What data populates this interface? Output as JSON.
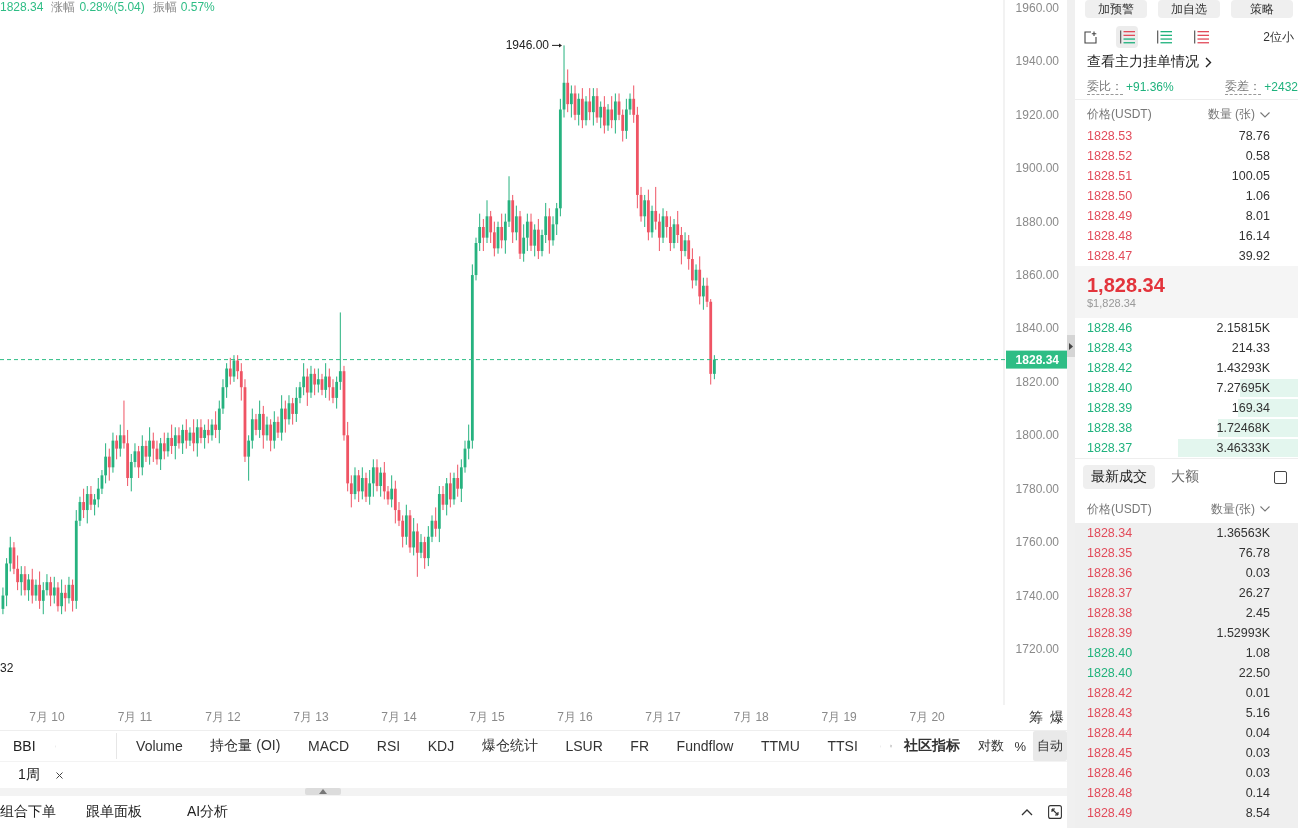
{
  "header": {
    "price": "1828.34",
    "stats": [
      {
        "label": "涨幅",
        "value": "0.28%(5.04)"
      },
      {
        "label": "振幅",
        "value": "0.57%"
      }
    ]
  },
  "chart": {
    "chart_data": [
      {
        "type": "candlestick",
        "categories": [
          null,
          null,
          null,
          null,
          null,
          null,
          null,
          null,
          null,
          null,
          null,
          null,
          "7月 10",
          null,
          null,
          null,
          null,
          null,
          null,
          null,
          null,
          null,
          null,
          null,
          null,
          null,
          null,
          null,
          null,
          null,
          null,
          null,
          null,
          null,
          null,
          null,
          "7月 11",
          null,
          null,
          null,
          null,
          null,
          null,
          null,
          null,
          null,
          null,
          null,
          null,
          null,
          null,
          null,
          null,
          null,
          null,
          null,
          null,
          null,
          null,
          null,
          "7月 12",
          null,
          null,
          null,
          null,
          null,
          null,
          null,
          null,
          null,
          null,
          null,
          null,
          null,
          null,
          null,
          null,
          null,
          null,
          null,
          null,
          null,
          null,
          null,
          "7月 13",
          null,
          null,
          null,
          null,
          null,
          null,
          null,
          null,
          null,
          null,
          null,
          null,
          null,
          null,
          null,
          null,
          null,
          null,
          null,
          null,
          null,
          null,
          null,
          "7月 14",
          null,
          null,
          null,
          null,
          null,
          null,
          null,
          null,
          null,
          null,
          null,
          null,
          null,
          null,
          null,
          null,
          null,
          null,
          null,
          null,
          null,
          null,
          null,
          "7月 15",
          null,
          null,
          null,
          null,
          null,
          null,
          null,
          null,
          null,
          null,
          null,
          null,
          null,
          null,
          null,
          null,
          null,
          null,
          null,
          null,
          null,
          null,
          null,
          "7月 16",
          null,
          null,
          null,
          null,
          null,
          null,
          null,
          null,
          null,
          null,
          null,
          null,
          null,
          null,
          null,
          null,
          null,
          null,
          null,
          null,
          null,
          null,
          null,
          "7月 17",
          null,
          null,
          null,
          null,
          null,
          null,
          null,
          null,
          null,
          null,
          null,
          null,
          null,
          null,
          null,
          null,
          null,
          null,
          null,
          null,
          null,
          null,
          null,
          "7月 18",
          null,
          null,
          null,
          null,
          null,
          null,
          null,
          null,
          null,
          null,
          null,
          null,
          null,
          null,
          null,
          null,
          null,
          null,
          null,
          null,
          null,
          null,
          null,
          "7月 19",
          null,
          null,
          null,
          null,
          null,
          null,
          null,
          null,
          null,
          null,
          null,
          null,
          null,
          null,
          null,
          null,
          null,
          null,
          null,
          null,
          null,
          null,
          null,
          "7月 20",
          null,
          null,
          null,
          null,
          null,
          null,
          null,
          null,
          null,
          null,
          null,
          null,
          null,
          null,
          null,
          null,
          null,
          null,
          null,
          null
        ],
        "ohlc": [
          [
            1735,
            1743,
            1733,
            1740
          ],
          [
            1740,
            1754,
            1736,
            1752
          ],
          [
            1752,
            1762,
            1749,
            1758
          ],
          [
            1758,
            1760,
            1748,
            1750
          ],
          [
            1750,
            1755,
            1742,
            1745
          ],
          [
            1745,
            1751,
            1740,
            1748
          ],
          [
            1748,
            1751,
            1740,
            1742
          ],
          [
            1742,
            1748,
            1738,
            1746
          ],
          [
            1746,
            1750,
            1737,
            1740
          ],
          [
            1740,
            1746,
            1738,
            1744
          ],
          [
            1744,
            1749,
            1735,
            1738
          ],
          [
            1738,
            1745,
            1733,
            1742
          ],
          [
            1742,
            1748,
            1740,
            1745
          ],
          [
            1745,
            1747,
            1736,
            1740
          ],
          [
            1740,
            1747,
            1737,
            1743
          ],
          [
            1743,
            1745,
            1734,
            1736
          ],
          [
            1736,
            1746,
            1733,
            1741
          ],
          [
            1741,
            1744,
            1734,
            1739
          ],
          [
            1739,
            1747,
            1737,
            1744
          ],
          [
            1744,
            1746,
            1734,
            1738
          ],
          [
            1738,
            1772,
            1735,
            1768
          ],
          [
            1768,
            1777,
            1766,
            1775
          ],
          [
            1775,
            1780,
            1769,
            1772
          ],
          [
            1772,
            1781,
            1767,
            1778
          ],
          [
            1778,
            1781,
            1772,
            1774
          ],
          [
            1774,
            1778,
            1770,
            1776
          ],
          [
            1776,
            1784,
            1773,
            1780
          ],
          [
            1780,
            1787,
            1778,
            1785
          ],
          [
            1785,
            1797,
            1782,
            1792
          ],
          [
            1792,
            1795,
            1783,
            1788
          ],
          [
            1788,
            1801,
            1786,
            1798
          ],
          [
            1798,
            1800,
            1791,
            1795
          ],
          [
            1795,
            1804,
            1792,
            1800
          ],
          [
            1800,
            1813,
            1795,
            1797
          ],
          [
            1797,
            1802,
            1781,
            1784
          ],
          [
            1784,
            1793,
            1779,
            1790
          ],
          [
            1790,
            1797,
            1788,
            1794
          ],
          [
            1794,
            1796,
            1784,
            1788
          ],
          [
            1788,
            1800,
            1785,
            1796
          ],
          [
            1796,
            1798,
            1790,
            1792
          ],
          [
            1792,
            1803,
            1789,
            1798
          ],
          [
            1798,
            1801,
            1790,
            1795
          ],
          [
            1795,
            1798,
            1789,
            1791
          ],
          [
            1791,
            1799,
            1787,
            1797
          ],
          [
            1797,
            1801,
            1791,
            1794
          ],
          [
            1794,
            1801,
            1792,
            1799
          ],
          [
            1799,
            1804,
            1793,
            1796
          ],
          [
            1796,
            1803,
            1791,
            1800
          ],
          [
            1800,
            1803,
            1795,
            1797
          ],
          [
            1797,
            1804,
            1793,
            1802
          ],
          [
            1802,
            1806,
            1795,
            1798
          ],
          [
            1798,
            1803,
            1796,
            1801
          ],
          [
            1801,
            1806,
            1794,
            1797
          ],
          [
            1797,
            1806,
            1792,
            1803
          ],
          [
            1803,
            1806,
            1797,
            1799
          ],
          [
            1799,
            1804,
            1795,
            1802
          ],
          [
            1802,
            1806,
            1797,
            1800
          ],
          [
            1800,
            1806,
            1798,
            1804
          ],
          [
            1804,
            1809,
            1799,
            1802
          ],
          [
            1802,
            1813,
            1797,
            1810
          ],
          [
            1810,
            1821,
            1808,
            1818
          ],
          [
            1818,
            1827,
            1814,
            1825
          ],
          [
            1825,
            1829,
            1819,
            1822
          ],
          [
            1822,
            1830,
            1820,
            1828
          ],
          [
            1828,
            1830,
            1821,
            1824
          ],
          [
            1824,
            1827,
            1813,
            1818
          ],
          [
            1818,
            1821,
            1790,
            1792
          ],
          [
            1792,
            1800,
            1783,
            1798
          ],
          [
            1798,
            1810,
            1795,
            1806
          ],
          [
            1806,
            1808,
            1800,
            1802
          ],
          [
            1802,
            1813,
            1799,
            1808
          ],
          [
            1808,
            1811,
            1795,
            1800
          ],
          [
            1800,
            1807,
            1798,
            1804
          ],
          [
            1804,
            1806,
            1794,
            1798
          ],
          [
            1798,
            1809,
            1795,
            1805
          ],
          [
            1805,
            1807,
            1799,
            1801
          ],
          [
            1801,
            1815,
            1798,
            1810
          ],
          [
            1810,
            1813,
            1801,
            1806
          ],
          [
            1806,
            1815,
            1804,
            1812
          ],
          [
            1812,
            1814,
            1804,
            1808
          ],
          [
            1808,
            1818,
            1805,
            1814
          ],
          [
            1814,
            1820,
            1812,
            1818
          ],
          [
            1818,
            1827,
            1815,
            1822
          ],
          [
            1822,
            1825,
            1811,
            1816
          ],
          [
            1816,
            1826,
            1814,
            1823
          ],
          [
            1823,
            1825,
            1815,
            1819
          ],
          [
            1819,
            1825,
            1816,
            1821
          ],
          [
            1821,
            1823,
            1815,
            1817
          ],
          [
            1817,
            1827,
            1814,
            1822
          ],
          [
            1822,
            1825,
            1813,
            1818
          ],
          [
            1818,
            1821,
            1812,
            1814
          ],
          [
            1814,
            1822,
            1810,
            1820
          ],
          [
            1820,
            1846,
            1817,
            1824
          ],
          [
            1824,
            1826,
            1798,
            1800
          ],
          [
            1800,
            1805,
            1779,
            1782
          ],
          [
            1782,
            1785,
            1773,
            1778
          ],
          [
            1778,
            1788,
            1776,
            1785
          ],
          [
            1785,
            1787,
            1775,
            1779
          ],
          [
            1779,
            1788,
            1776,
            1784
          ],
          [
            1784,
            1786,
            1775,
            1777
          ],
          [
            1777,
            1787,
            1774,
            1782
          ],
          [
            1782,
            1791,
            1777,
            1788
          ],
          [
            1788,
            1791,
            1779,
            1781
          ],
          [
            1781,
            1788,
            1777,
            1786
          ],
          [
            1786,
            1790,
            1776,
            1779
          ],
          [
            1779,
            1781,
            1774,
            1776
          ],
          [
            1776,
            1785,
            1773,
            1780
          ],
          [
            1780,
            1783,
            1767,
            1772
          ],
          [
            1772,
            1775,
            1766,
            1768
          ],
          [
            1768,
            1770,
            1758,
            1762
          ],
          [
            1762,
            1774,
            1759,
            1770
          ],
          [
            1770,
            1772,
            1756,
            1758
          ],
          [
            1758,
            1769,
            1755,
            1764
          ],
          [
            1764,
            1767,
            1747,
            1756
          ],
          [
            1756,
            1763,
            1754,
            1760
          ],
          [
            1760,
            1762,
            1750,
            1754
          ],
          [
            1754,
            1766,
            1751,
            1762
          ],
          [
            1762,
            1770,
            1760,
            1768
          ],
          [
            1768,
            1773,
            1762,
            1765
          ],
          [
            1765,
            1781,
            1760,
            1778
          ],
          [
            1778,
            1781,
            1772,
            1774
          ],
          [
            1774,
            1784,
            1770,
            1782
          ],
          [
            1782,
            1786,
            1773,
            1776
          ],
          [
            1776,
            1786,
            1774,
            1784
          ],
          [
            1784,
            1789,
            1777,
            1780
          ],
          [
            1780,
            1791,
            1775,
            1788
          ],
          [
            1788,
            1798,
            1786,
            1795
          ],
          [
            1795,
            1804,
            1791,
            1798
          ],
          [
            1798,
            1864,
            1795,
            1860
          ],
          [
            1860,
            1874,
            1858,
            1872
          ],
          [
            1872,
            1883,
            1869,
            1878
          ],
          [
            1878,
            1881,
            1869,
            1874
          ],
          [
            1874,
            1888,
            1872,
            1882
          ],
          [
            1882,
            1884,
            1872,
            1876
          ],
          [
            1876,
            1880,
            1867,
            1870
          ],
          [
            1870,
            1880,
            1868,
            1878
          ],
          [
            1878,
            1883,
            1870,
            1873
          ],
          [
            1873,
            1883,
            1868,
            1880
          ],
          [
            1880,
            1897,
            1878,
            1888
          ],
          [
            1888,
            1890,
            1872,
            1876
          ],
          [
            1876,
            1886,
            1873,
            1882
          ],
          [
            1882,
            1884,
            1866,
            1868
          ],
          [
            1868,
            1879,
            1865,
            1874
          ],
          [
            1874,
            1883,
            1869,
            1880
          ],
          [
            1880,
            1883,
            1869,
            1871
          ],
          [
            1871,
            1879,
            1867,
            1877
          ],
          [
            1877,
            1881,
            1866,
            1869
          ],
          [
            1869,
            1877,
            1867,
            1875
          ],
          [
            1875,
            1887,
            1872,
            1882
          ],
          [
            1882,
            1885,
            1868,
            1873
          ],
          [
            1873,
            1882,
            1871,
            1879
          ],
          [
            1879,
            1887,
            1875,
            1885
          ],
          [
            1885,
            1926,
            1882,
            1922
          ],
          [
            1922,
            1946,
            1919,
            1932
          ],
          [
            1932,
            1937,
            1921,
            1924
          ],
          [
            1924,
            1931,
            1919,
            1928
          ],
          [
            1928,
            1931,
            1918,
            1920
          ],
          [
            1920,
            1928,
            1916,
            1926
          ],
          [
            1926,
            1930,
            1915,
            1918
          ],
          [
            1918,
            1927,
            1916,
            1925
          ],
          [
            1925,
            1930,
            1918,
            1921
          ],
          [
            1921,
            1930,
            1916,
            1927
          ],
          [
            1927,
            1930,
            1917,
            1919
          ],
          [
            1919,
            1925,
            1915,
            1923
          ],
          [
            1923,
            1927,
            1913,
            1916
          ],
          [
            1916,
            1924,
            1914,
            1922
          ],
          [
            1922,
            1927,
            1915,
            1918
          ],
          [
            1918,
            1928,
            1913,
            1925
          ],
          [
            1925,
            1928,
            1918,
            1920
          ],
          [
            1920,
            1922,
            1910,
            1914
          ],
          [
            1914,
            1926,
            1911,
            1922
          ],
          [
            1922,
            1928,
            1920,
            1926
          ],
          [
            1926,
            1931,
            1917,
            1920
          ],
          [
            1920,
            1923,
            1885,
            1890
          ],
          [
            1890,
            1893,
            1880,
            1882
          ],
          [
            1882,
            1890,
            1878,
            1888
          ],
          [
            1888,
            1892,
            1873,
            1876
          ],
          [
            1876,
            1886,
            1874,
            1884
          ],
          [
            1884,
            1893,
            1877,
            1880
          ],
          [
            1880,
            1883,
            1869,
            1874
          ],
          [
            1874,
            1885,
            1872,
            1882
          ],
          [
            1882,
            1884,
            1874,
            1878
          ],
          [
            1878,
            1882,
            1869,
            1872
          ],
          [
            1872,
            1881,
            1870,
            1879
          ],
          [
            1879,
            1884,
            1872,
            1875
          ],
          [
            1875,
            1878,
            1864,
            1869
          ],
          [
            1869,
            1876,
            1867,
            1873
          ],
          [
            1873,
            1875,
            1862,
            1866
          ],
          [
            1866,
            1870,
            1855,
            1858
          ],
          [
            1858,
            1864,
            1856,
            1862
          ],
          [
            1862,
            1867,
            1849,
            1852
          ],
          [
            1852,
            1859,
            1847,
            1856
          ],
          [
            1856,
            1859,
            1848,
            1850
          ],
          [
            1850,
            1851,
            1819,
            1823
          ],
          [
            1823,
            1830,
            1821,
            1828.34
          ],
          null,
          null,
          null,
          null,
          null,
          null,
          null,
          null,
          null,
          null,
          null,
          null,
          null,
          null,
          null,
          null,
          null,
          null,
          null,
          null,
          null,
          null,
          null,
          null,
          null,
          null,
          null,
          null,
          null,
          null,
          null,
          null,
          null,
          null,
          null,
          null,
          null,
          null,
          null,
          null,
          null,
          null,
          null,
          null,
          null,
          null,
          null,
          null,
          null,
          null,
          null,
          null,
          null,
          null,
          null,
          null,
          null,
          null,
          null,
          null,
          null,
          null,
          null,
          null,
          null,
          null,
          null,
          null,
          null,
          null,
          null,
          null,
          null,
          null,
          null,
          null,
          null,
          null
        ],
        "ylim": [
          1699,
          1963
        ],
        "yticks": [
          {
            "value": 1960,
            "label": "1960.00"
          },
          {
            "value": 1940,
            "label": "1940.00"
          },
          {
            "value": 1920,
            "label": "1920.00"
          },
          {
            "value": 1900,
            "label": "1900.00"
          },
          {
            "value": 1880,
            "label": "1880.00"
          },
          {
            "value": 1860,
            "label": "1860.00"
          },
          {
            "value": 1840,
            "label": "1840.00"
          },
          {
            "value": 1820,
            "label": "1820.00"
          },
          {
            "value": 1800,
            "label": "1800.00"
          },
          {
            "value": 1780,
            "label": "1780.00"
          },
          {
            "value": 1760,
            "label": "1760.00"
          },
          {
            "value": 1740,
            "label": "1740.00"
          },
          {
            "value": 1720,
            "label": "1720.00"
          }
        ],
        "ref_lines": [
          {
            "axis": "y",
            "value": 1828.34,
            "label": "1828.34",
            "color": "#2ebd85",
            "line_style": "dashed"
          }
        ],
        "annotations": [
          "1946.00",
          "32"
        ]
      }
    ],
    "axis_buttons": [
      "筹",
      "爆"
    ]
  },
  "indicator_bar": {
    "main": "BBI",
    "tabs": [
      "Volume",
      "持仓量 (OI)",
      "MACD",
      "RSI",
      "KDJ",
      "爆仓统计",
      "LSUR",
      "FR",
      "Fundflow",
      "TTMU",
      "TTSI"
    ],
    "community": "社区指标",
    "scale_options": [
      {
        "label": "对数",
        "selected": false
      },
      {
        "label": "%",
        "selected": false
      },
      {
        "label": "自动",
        "selected": true
      }
    ]
  },
  "chart_tags": [
    "1周"
  ],
  "bottom_tabs": [
    "组合下单",
    "跟单面板",
    "AI分析"
  ],
  "right_panel": {
    "actions": [
      "加预警",
      "加自选",
      "策略"
    ],
    "view_modes": [
      {
        "kind": "both",
        "selected": true
      },
      {
        "kind": "bids",
        "selected": false
      },
      {
        "kind": "asks",
        "selected": false
      }
    ],
    "precision": "2位小",
    "depth_link": "查看主力挂单情况",
    "ratio": {
      "label": "委比：",
      "value": "+91.36%"
    },
    "diff": {
      "label": "委差：",
      "value": "+2432"
    },
    "book_columns": [
      "价格(USDT)",
      "数量 (张)"
    ],
    "asks": [
      {
        "price": "1828.53",
        "amount": "78.76"
      },
      {
        "price": "1828.52",
        "amount": "0.58"
      },
      {
        "price": "1828.51",
        "amount": "100.05"
      },
      {
        "price": "1828.50",
        "amount": "1.06"
      },
      {
        "price": "1828.49",
        "amount": "8.01"
      },
      {
        "price": "1828.48",
        "amount": "16.14"
      },
      {
        "price": "1828.47",
        "amount": "39.92"
      }
    ],
    "last_price": "1,828.34",
    "last_price_usd": "$1,828.34",
    "bids": [
      {
        "price": "1828.46",
        "amount": "2.15815K"
      },
      {
        "price": "1828.43",
        "amount": "214.33"
      },
      {
        "price": "1828.42",
        "amount": "1.43293K"
      },
      {
        "price": "1828.40",
        "amount": "7.27695K",
        "level": 0.26
      },
      {
        "price": "1828.39",
        "amount": "169.34",
        "level": 0.27
      },
      {
        "price": "1828.38",
        "amount": "1.72468K",
        "level": 0.36
      },
      {
        "price": "1828.37",
        "amount": "3.46333K",
        "level": 0.54
      }
    ],
    "trade_tabs": [
      {
        "label": "最新成交",
        "selected": true
      },
      {
        "label": "大额",
        "selected": false
      }
    ],
    "large_only": {
      "checked": false
    },
    "trade_columns": [
      "价格(USDT)",
      "数量(张)"
    ],
    "trades": [
      {
        "price": "1828.34",
        "amount": "1.36563K",
        "color": "#e24b5a"
      },
      {
        "price": "1828.35",
        "amount": "76.78",
        "color": "#e24b5a"
      },
      {
        "price": "1828.36",
        "amount": "0.03",
        "color": "#e24b5a"
      },
      {
        "price": "1828.37",
        "amount": "26.27",
        "color": "#e24b5a"
      },
      {
        "price": "1828.38",
        "amount": "2.45",
        "color": "#e24b5a"
      },
      {
        "price": "1828.39",
        "amount": "1.52993K",
        "color": "#e24b5a"
      },
      {
        "price": "1828.40",
        "amount": "1.08",
        "color": "#1fb27d"
      },
      {
        "price": "1828.40",
        "amount": "22.50",
        "color": "#1fb27d"
      },
      {
        "price": "1828.42",
        "amount": "0.01",
        "color": "#e24b5a"
      },
      {
        "price": "1828.43",
        "amount": "5.16",
        "color": "#e24b5a"
      },
      {
        "price": "1828.44",
        "amount": "0.04",
        "color": "#e24b5a"
      },
      {
        "price": "1828.45",
        "amount": "0.03",
        "color": "#e24b5a"
      },
      {
        "price": "1828.46",
        "amount": "0.03",
        "color": "#e24b5a"
      },
      {
        "price": "1828.48",
        "amount": "0.14",
        "color": "#e24b5a"
      },
      {
        "price": "1828.49",
        "amount": "8.54",
        "color": "#e24b5a"
      }
    ]
  }
}
